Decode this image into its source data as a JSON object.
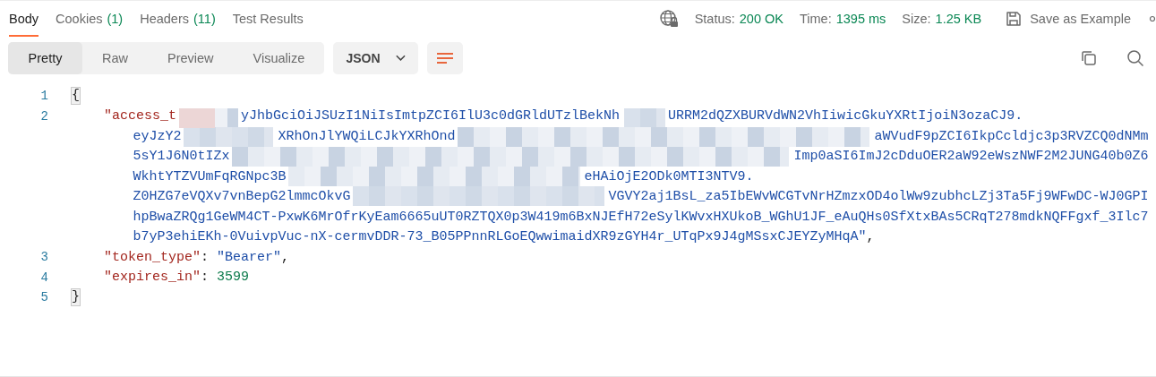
{
  "response_tabs": [
    {
      "label": "Body",
      "selected": true
    },
    {
      "label": "Cookies",
      "count": "(1)",
      "selected": false
    },
    {
      "label": "Headers",
      "count": "(11)",
      "selected": false
    },
    {
      "label": "Test Results",
      "selected": false
    }
  ],
  "response_meta": [
    {
      "label": "Status:",
      "value": "200 OK"
    },
    {
      "label": "Time:",
      "value": "1395 ms"
    },
    {
      "label": "Size:",
      "value": "1.25 KB"
    }
  ],
  "save_button": {
    "label": "Save as Example"
  },
  "view_modes": [
    {
      "label": "Pretty",
      "selected": true
    },
    {
      "label": "Raw",
      "selected": false
    },
    {
      "label": "Preview",
      "selected": false
    },
    {
      "label": "Visualize",
      "selected": false
    }
  ],
  "format_dropdown": {
    "value": "JSON"
  },
  "code_lines": [
    {
      "number": "1",
      "rows": [
        [
          {
            "kind": "brace",
            "text": "{"
          }
        ]
      ],
      "children": [
        {
          "number": "2",
          "rows": [
            [
              {
                "kind": "key",
                "text": "\"access_t"
              },
              {
                "kind": "string",
                "text": "yJhbGciOiJSUzI1NiIsImtpZCI6IlU3c0dGRldUTzlBekNh"
              },
              {
                "kind": "string",
                "text": "URRM2dQZXBURVdWN2VhIiwicGkuYXRtIjoiN3ozaCJ9."
              }
            ],
            [
              {
                "kind": "string",
                "text": "eyJzY2"
              },
              {
                "kind": "string",
                "text": "XRhOnJlYWQiLCJkYXRhOnd"
              },
              {
                "kind": "string",
                "text": "aWVudF9pZCI6IkpCcldjc3p3RVZCQ0dNMm"
              }
            ],
            [
              {
                "kind": "string",
                "text": "5sY1J6N0tIZx"
              },
              {
                "kind": "string",
                "text": "Imp0aSI6ImJ2cDduOER2aW92eWszNWF2M2JUNG40b0Z6"
              }
            ],
            [
              {
                "kind": "string",
                "text": "WkhtYTZVUmFqRGNpc3B"
              },
              {
                "kind": "string",
                "text": "eHAiOjE2ODk0MTI3NTV9."
              }
            ],
            [
              {
                "kind": "string",
                "text": "Z0HZG7eVQXv7vnBepG2lmmcOkvG"
              },
              {
                "kind": "string",
                "text": "VGVY2aj1BsL_za5IbEWvWCGTvNrHZmzxOD4olWw9zubhcLZj3Ta5Fj9WFwDC-WJ0GPI"
              }
            ],
            [
              {
                "kind": "string",
                "text": "hpBwaZRQg1GeWM4CT-PxwK6MrOfrKyEam6665uUT0RZTQX0p3W419m6BxNJEfH72eSylKWvxHXUkoB_WGhU1JF_eAuQHs0SfXtxBAs5CRqT278mdkNQFFgxf_3Ilc7"
              }
            ],
            [
              {
                "kind": "string",
                "text": "b7yP3ehiEKh-0VuivpVuc-nX-cermvDDR-73_B05PPnnRLGoEQwwimaidXR9zGYH4r_UTqPx9J4gMSsxCJEYZyMHqA\""
              },
              {
                "kind": "punct",
                "text": ","
              }
            ]
          ]
        },
        {
          "number": "3",
          "rows": [
            [
              {
                "kind": "key",
                "text": "\"token_type\""
              },
              {
                "kind": "punct",
                "text": ": "
              },
              {
                "kind": "string",
                "text": "\"Bearer\""
              },
              {
                "kind": "punct",
                "text": ","
              }
            ]
          ]
        },
        {
          "number": "4",
          "rows": [
            [
              {
                "kind": "key",
                "text": "\"expires_in\""
              },
              {
                "kind": "punct",
                "text": ": "
              },
              {
                "kind": "number",
                "text": "3599"
              }
            ]
          ]
        }
      ]
    },
    {
      "number": "5",
      "rows": [
        [
          {
            "kind": "brace",
            "text": "}"
          }
        ]
      ]
    }
  ]
}
